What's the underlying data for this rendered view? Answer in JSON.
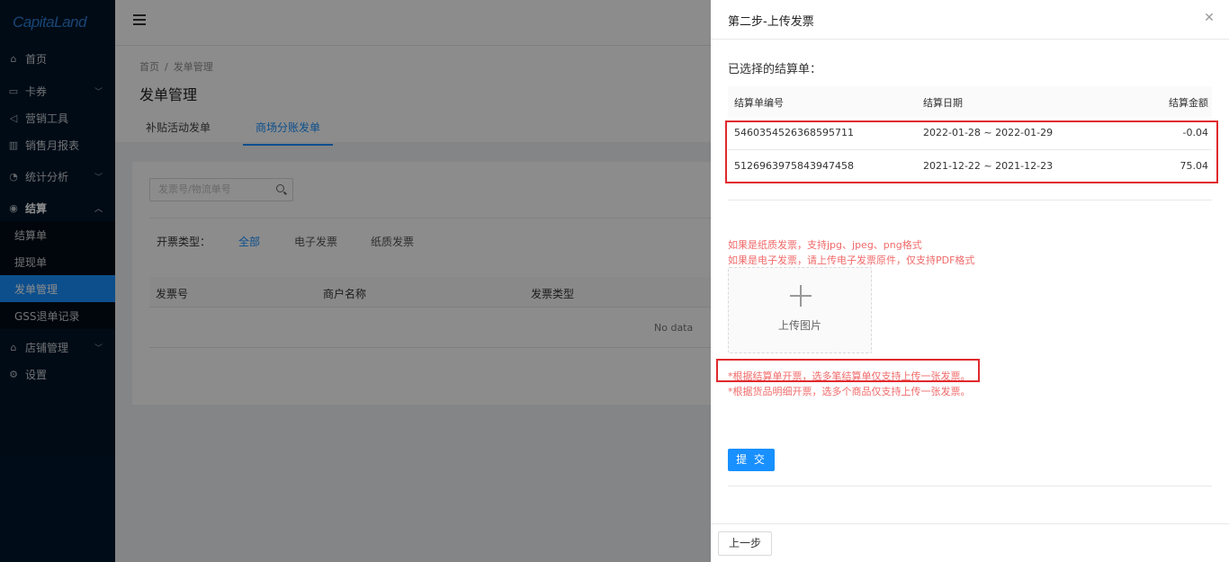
{
  "logo": {
    "text": "CapitaLand"
  },
  "sidebar": {
    "items": [
      {
        "label": "首页",
        "icon": "home-icon"
      },
      {
        "label": "卡券",
        "icon": "card-icon"
      },
      {
        "label": "营销工具",
        "icon": "megaphone-icon"
      },
      {
        "label": "销售月报表",
        "icon": "bar-chart-icon"
      },
      {
        "label": "统计分析",
        "icon": "pie-chart-icon"
      },
      {
        "label": "结算",
        "icon": "settlement-icon"
      },
      {
        "label": "店铺管理",
        "icon": "shop-icon"
      },
      {
        "label": "设置",
        "icon": "gear-icon"
      }
    ],
    "sub_items": [
      {
        "label": "结算单"
      },
      {
        "label": "提现单"
      },
      {
        "label": "发单管理"
      },
      {
        "label": "GSS退单记录"
      }
    ]
  },
  "breadcrumb": {
    "home": "首页",
    "sep": "/",
    "current": "发单管理"
  },
  "page": {
    "title": "发单管理"
  },
  "tabs": [
    {
      "label": "补贴活动发单"
    },
    {
      "label": "商场分账发单"
    }
  ],
  "search": {
    "placeholder": "发票号/物流单号"
  },
  "filter": {
    "label": "开票类型：",
    "options": [
      "全部",
      "电子发票",
      "纸质发票"
    ]
  },
  "table": {
    "headers": [
      "发票号",
      "商户名称",
      "发票类型"
    ],
    "empty": "No data"
  },
  "drawer": {
    "title": "第二步-上传发票",
    "selected_label": "已选择的结算单：",
    "columns": [
      "结算单编号",
      "结算日期",
      "结算金额"
    ],
    "rows": [
      {
        "id": "5460354526368595711",
        "date": "2022-01-28 ~ 2022-01-29",
        "amount": "-0.04"
      },
      {
        "id": "5126963975843947458",
        "date": "2021-12-22 ~ 2021-12-23",
        "amount": "75.04"
      }
    ],
    "hint_paper": "如果是纸质发票，支持jpg、jpeg、png格式",
    "hint_electronic": "如果是电子发票，请上传电子发票原件，仅支持PDF格式",
    "upload_label": "上传图片",
    "note1": "*根据结算单开票，选多笔结算单仅支持上传一张发票。",
    "note2": "*根据货品明细开票，选多个商品仅支持上传一张发票。",
    "submit": "提 交",
    "prev": "上一步"
  }
}
